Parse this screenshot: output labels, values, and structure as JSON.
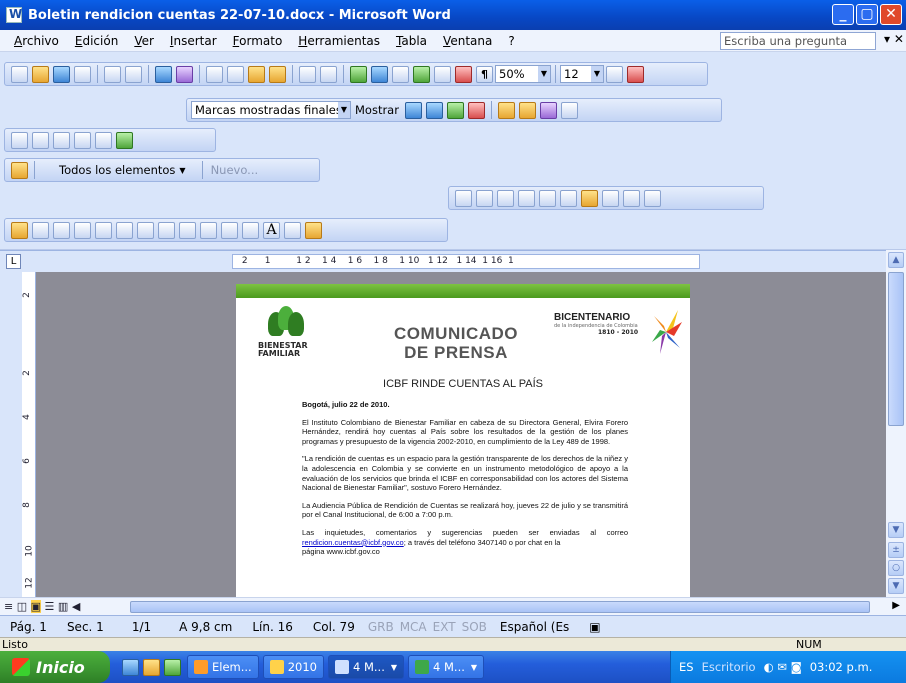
{
  "window": {
    "title": "Boletin rendicion cuentas 22-07-10.docx - Microsoft Word"
  },
  "menu": {
    "items": [
      "Archivo",
      "Edición",
      "Ver",
      "Insertar",
      "Formato",
      "Herramientas",
      "Tabla",
      "Ventana",
      "?"
    ],
    "ask_placeholder": "Escriba una pregunta"
  },
  "toolbar": {
    "zoom": "50%",
    "font_size": "12",
    "markup_view": "Marcas mostradas finales",
    "mostrar_label": "Mostrar",
    "elements_label": "Todos los elementos",
    "nuevo_label": "Nuevo..."
  },
  "ruler": {
    "scale_text": " 2      1         1 2    1 4    1 6    1 8    1 10   1 12   1 14  1 16  1"
  },
  "vruler": {
    "ticks": [
      "2",
      "2",
      "4",
      "6",
      "8",
      "10",
      "12"
    ]
  },
  "document": {
    "headline_1": "COMUNICADO",
    "headline_2": "DE PRENSA",
    "logo_left_1": "BIENESTAR",
    "logo_left_2": "FAMILIAR",
    "logo_right_1": "BICENTENARIO",
    "logo_right_2": "de la independencia de Colombia",
    "logo_right_3": "1810 - 2010",
    "title": "ICBF RINDE CUENTAS AL PAÍS",
    "date_line": "Bogotá, julio 22 de 2010.",
    "para_1": "El Instituto Colombiano de Bienestar Familiar en cabeza de su Directora General, Elvira Forero Hernández, rendirá hoy cuentas al País sobre los resultados de la gestión de los planes programas y presupuesto de la vigencia 2002-2010, en cumplimiento de la Ley 489 de 1998.",
    "para_2": "\"La rendición de cuentas es un espacio para la gestión transparente de los derechos de la niñez y la adolescencia en Colombia y se convierte en un instrumento metodológico de apoyo a la evaluación de los servicios que brinda el ICBF en corresponsabilidad con los actores del Sistema Nacional de Bienestar Familiar\", sostuvo Forero Hernández.",
    "para_3": "La Audiencia Pública de Rendición de Cuentas se realizará hoy, jueves 22 de julio y se transmitirá por el Canal Institucional, de 6:00 a 7:00 p.m.",
    "para_4_a": "Las inquietudes, comentarios y sugerencias pueden ser enviadas al correo ",
    "para_4_link": "rendicion.cuentas@icbf.gov.co",
    "para_4_b": "; a través del teléfono 3407140 o por chat en la",
    "para_4_c": "página www.icbf.gov.co"
  },
  "status": {
    "page": "Pág. 1",
    "section": "Sec. 1",
    "pages": "1/1",
    "at": "A 9,8 cm",
    "line": "Lín. 16",
    "col": "Col. 79",
    "grb": "GRB",
    "mca": "MCA",
    "ext": "EXT",
    "sob": "SOB",
    "language": "Español (Es",
    "ready": "Listo",
    "num": "NUM"
  },
  "taskbar": {
    "start": "Inicio",
    "tasks": [
      "Elem...",
      "2010",
      "4 M...",
      "4 M..."
    ],
    "lang": "ES",
    "desktop": "Escritorio",
    "clock": "03:02 p.m."
  }
}
